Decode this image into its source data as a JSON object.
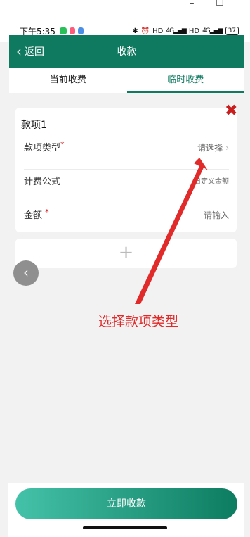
{
  "window": {
    "minimize": "–",
    "maximize": "☐"
  },
  "status_bar": {
    "time": "下午5:35",
    "hd1": "HD",
    "net": "4G",
    "hd2": "HD",
    "net2": "4G",
    "battery": "37"
  },
  "header": {
    "back_label": "返回",
    "title": "收款"
  },
  "tabs": [
    {
      "label": "当前收费"
    },
    {
      "label": "临时收费"
    }
  ],
  "card": {
    "title": "款项1",
    "rows": [
      {
        "label": "款项类型",
        "required": "*",
        "value": "请选择"
      },
      {
        "label": "计费公式",
        "value": "自定义金额"
      },
      {
        "label": "金额",
        "required": "*",
        "value": "请输入"
      }
    ]
  },
  "add_icon": "+",
  "annotation": "选择款项类型",
  "footer": {
    "pay_label": "立即收款"
  },
  "colors": {
    "brand": "#0f7a5f",
    "annotation": "#e12a2a"
  }
}
